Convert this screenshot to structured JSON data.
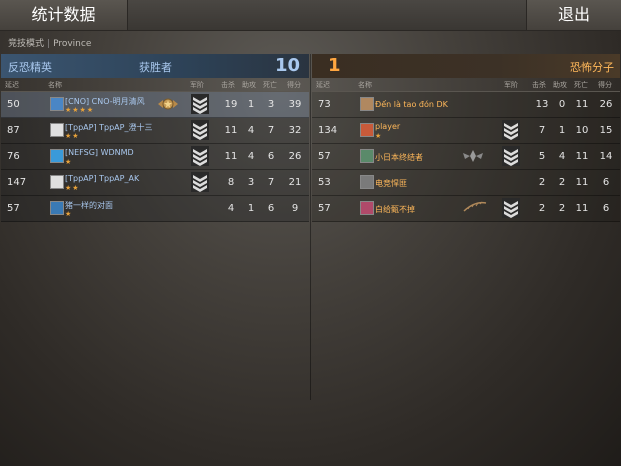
{
  "header": {
    "title": "统计数据",
    "exit_label": "退出"
  },
  "mode": {
    "type": "竞技模式",
    "separator": "|",
    "map": "Province"
  },
  "columns": {
    "ping": "延迟",
    "name": "名称",
    "rank": "军阶",
    "kills": "击杀",
    "assists": "助攻",
    "deaths": "死亡",
    "score": "得分"
  },
  "teams": {
    "ct": {
      "name": "反恐精英",
      "result": "获胜者",
      "score": "10",
      "color": "#a9c8ee",
      "players": [
        {
          "ping": "50",
          "name": "[CNO] CNO-明月清风",
          "stars": "★★★★",
          "kills": "19",
          "assists": "1",
          "deaths": "3",
          "score": "39",
          "avatar_color": "#4a86c5",
          "rank_icon": "chevron-rank-icon",
          "badge": "medal-badge-icon"
        },
        {
          "ping": "87",
          "name": "[TppAP] TppAP_澄十三",
          "stars": "★★",
          "kills": "11",
          "assists": "4",
          "deaths": "7",
          "score": "32",
          "avatar_color": "#e0e0e0",
          "rank_icon": "chevron-rank-icon"
        },
        {
          "ping": "76",
          "name": "[NEFSG] WDNMD",
          "stars": "★",
          "kills": "11",
          "assists": "4",
          "deaths": "6",
          "score": "26",
          "avatar_color": "#3a9ad9",
          "rank_icon": "chevron-rank-icon"
        },
        {
          "ping": "147",
          "name": "[TppAP] TppAP_AK",
          "stars": "★★",
          "kills": "8",
          "assists": "3",
          "deaths": "7",
          "score": "21",
          "avatar_color": "#e0e0e0",
          "rank_icon": "chevron-rank-icon"
        },
        {
          "ping": "57",
          "name": "猪一样的对面",
          "stars": "★",
          "kills": "4",
          "assists": "1",
          "deaths": "6",
          "score": "9",
          "avatar_color": "#3a7ab5",
          "rank_icon": ""
        }
      ]
    },
    "t": {
      "name": "恐怖分子",
      "score": "1",
      "color": "#ffb85a",
      "players": [
        {
          "ping": "73",
          "name": "Đến là tao đón DK",
          "stars": "",
          "kills": "13",
          "assists": "0",
          "deaths": "11",
          "score": "26",
          "avatar_color": "#b08860",
          "rank_icon": ""
        },
        {
          "ping": "134",
          "name": "player",
          "stars": "★",
          "kills": "7",
          "assists": "1",
          "deaths": "10",
          "score": "15",
          "avatar_color": "#c85a3a",
          "rank_icon": "chevron-rank-icon"
        },
        {
          "ping": "57",
          "name": "小日本终结者",
          "stars": "",
          "kills": "5",
          "assists": "4",
          "deaths": "11",
          "score": "14",
          "avatar_color": "#5a8a6a",
          "rank_icon": "chevron-rank-icon",
          "badge": "wings-badge-icon"
        },
        {
          "ping": "53",
          "name": "电竞悍匪",
          "stars": "",
          "kills": "2",
          "assists": "2",
          "deaths": "11",
          "score": "6",
          "avatar_color": "#7a7a7a",
          "rank_icon": ""
        },
        {
          "ping": "57",
          "name": "白给甄不掉",
          "stars": "",
          "kills": "2",
          "assists": "2",
          "deaths": "11",
          "score": "6",
          "avatar_color": "#b04a6a",
          "rank_icon": "chevron-rank-icon",
          "badge": "feather-badge-icon"
        }
      ]
    }
  }
}
